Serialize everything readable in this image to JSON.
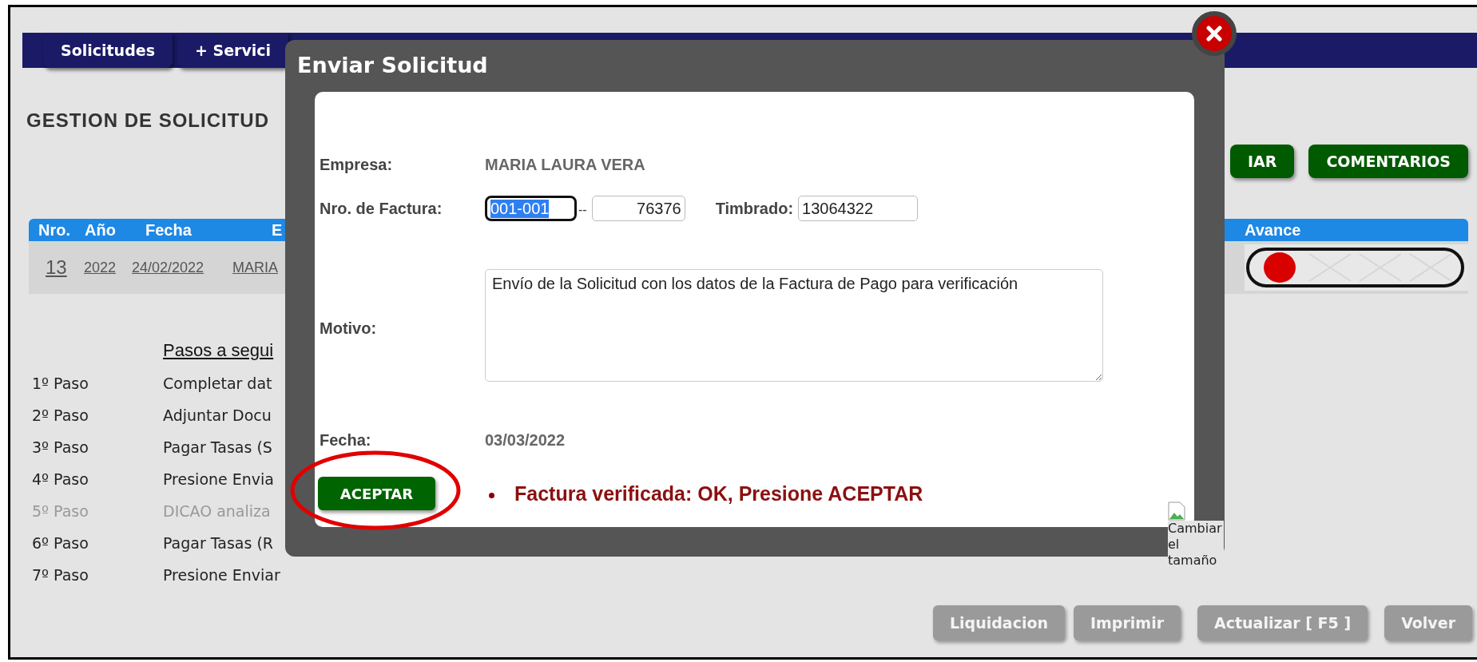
{
  "nav_tabs": [
    {
      "label": "Solicitudes"
    },
    {
      "label": "+ Servici"
    }
  ],
  "page_title": "GESTION DE SOLICITUD",
  "action_buttons": [
    "IAR",
    "COMENTARIOS"
  ],
  "table": {
    "columns": [
      "Nro.",
      "Año",
      "Fecha",
      "E",
      "Avance"
    ],
    "rows": [
      {
        "cells": [
          "13",
          "2022",
          "24/02/2022",
          "MARIA"
        ],
        "avance": [
          {
            "done": true
          },
          {
            "done": false
          },
          {
            "done": false
          },
          {
            "done": false
          }
        ]
      }
    ]
  },
  "steps": {
    "heading": "Pasos a segui",
    "items": [
      {
        "label": "1º Paso",
        "text": "Completar dat",
        "disabled": false
      },
      {
        "label": "2º Paso",
        "text": "Adjuntar Docu",
        "disabled": false
      },
      {
        "label": "3º Paso",
        "text": "Pagar Tasas (S",
        "disabled": false
      },
      {
        "label": "4º Paso",
        "text": "Presione Envia",
        "disabled": false
      },
      {
        "label": "5º Paso",
        "text": "DICAO analiza",
        "disabled": true
      },
      {
        "label": "6º Paso",
        "text": "Pagar Tasas (R",
        "disabled": false
      },
      {
        "label": "7º Paso",
        "text": "Presione Enviar",
        "disabled": false
      }
    ]
  },
  "footer_buttons": [
    "Liquidacion",
    "Imprimir",
    "Actualizar [ F5 ]",
    "Volver"
  ],
  "resize_image_alt": "Cambiar el tamaño",
  "modal": {
    "title": "Enviar Solicitud",
    "fields": [
      {
        "kind": "text",
        "label": "Empresa:",
        "value": "MARIA LAURA VERA"
      },
      {
        "kind": "invoice",
        "label": "Nro. de Factura:",
        "parts": [
          {
            "value": "001-001",
            "focused": true
          },
          {
            "value": "76376",
            "focused": false
          }
        ],
        "separator": "--",
        "extra_label": "Timbrado:",
        "extra_value": "13064322"
      },
      {
        "kind": "textarea",
        "label": "Motivo:",
        "value": "Envío de la Solicitud con los datos de la Factura de Pago para verificación"
      },
      {
        "kind": "text",
        "label": "Fecha:",
        "value": "03/03/2022"
      }
    ],
    "accept_button": "ACEPTAR",
    "accept_highlighted": true,
    "message": "Factura verificada: OK, Presione ACEPTAR"
  }
}
